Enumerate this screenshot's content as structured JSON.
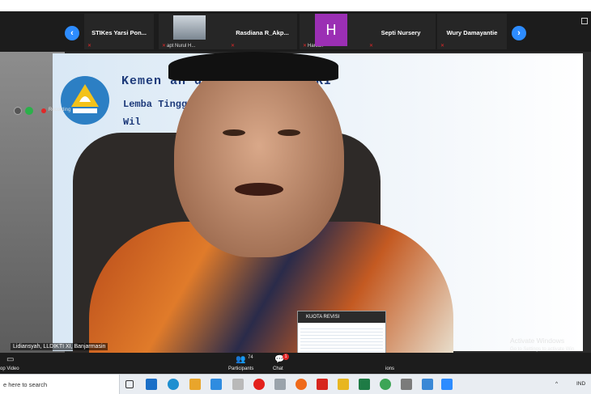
{
  "top_strip": {
    "nav_prev": "‹",
    "nav_next": "›",
    "tiles": [
      {
        "name": "STIKes Yarsi Pon...",
        "sub": ""
      },
      {
        "name": "",
        "sub": "apt Nurul H..."
      },
      {
        "name": "Rasdiana R_Akp...",
        "sub": ""
      },
      {
        "name": "",
        "sub": "Haniah"
      },
      {
        "name": "Septi Nursery",
        "sub": ""
      },
      {
        "name": "Wury Damayantie",
        "sub": ""
      }
    ],
    "avatar_letter": "H"
  },
  "main_video": {
    "recording_label": "Recording",
    "slide_line1": "Kemen                    an dan Kebudayaan RI",
    "slide_line2": "Lemba                      Tinggi (LLDIKTI)",
    "slide_line3": "Wil",
    "speaker_name": "Lidiansyah, LLDIKTI XI, Banjarmasin",
    "share_title": "KUOTA REVISI",
    "activate_title": "Activate Windows",
    "activate_sub": "Go to Settings to activate Win"
  },
  "toolbar": {
    "stop_video": "op Video",
    "participants_count": "74",
    "participants": "Participants",
    "chat": "Chat",
    "chat_badge": "1",
    "reactions": "ions"
  },
  "taskbar": {
    "search_placeholder": "e here to search",
    "language": "IND"
  },
  "colors": {
    "zoom_dark": "#1c1c1c",
    "accent_blue": "#2d8cff",
    "avatar_purple": "#9b2fb4",
    "mute_red": "#e02828"
  }
}
